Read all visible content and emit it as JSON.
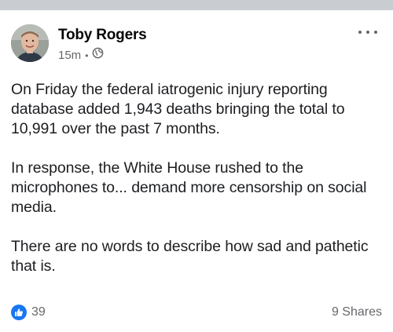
{
  "post": {
    "author": "Toby Rogers",
    "timestamp": "15m",
    "separator": "•",
    "privacy_icon": "globe-icon",
    "more_icon": "more-options-icon",
    "paragraphs": [
      "On Friday the federal iatrogenic injury reporting database added 1,943 deaths bringing the total to 10,991 over the past 7 months.",
      "In response, the White House rushed to the microphones to... demand more censorship on social media.",
      "There are no words to describe how sad and pathetic that is."
    ],
    "reactions": {
      "icon": "like-icon",
      "count": "39",
      "color": "#1877f2"
    },
    "shares": "9 Shares"
  }
}
